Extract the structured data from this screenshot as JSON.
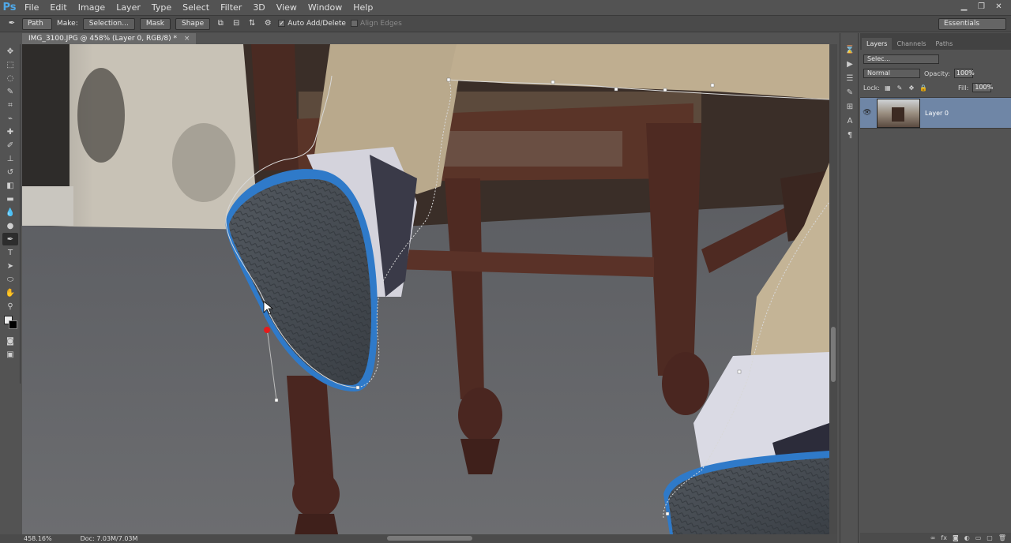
{
  "app": {
    "logo": "Ps"
  },
  "menu": [
    "File",
    "Edit",
    "Image",
    "Layer",
    "Type",
    "Select",
    "Filter",
    "3D",
    "View",
    "Window",
    "Help"
  ],
  "window_controls": {
    "minimize": "▁",
    "restore": "❐",
    "close": "✕"
  },
  "options_bar": {
    "tool_icon": "pen-icon",
    "mode": "Path",
    "make_label": "Make:",
    "selection_btn": "Selection...",
    "mask_btn": "Mask",
    "shape_btn": "Shape",
    "auto_add_delete": "Auto Add/Delete",
    "auto_add_checked": true,
    "align_edges": "Align Edges",
    "workspace": "Essentials"
  },
  "document": {
    "tab_title": "IMG_3100.JPG @ 458% (Layer 0, RGB/8) *",
    "close": "×"
  },
  "status": {
    "zoom": "458.16%",
    "doc": "Doc: 7.03M/7.03M"
  },
  "panels": {
    "tabs": [
      "Layers",
      "Channels",
      "Paths"
    ],
    "active_tab": "Layers",
    "filter_placeholder": "Selec...",
    "blend_mode": "Normal",
    "opacity_label": "Opacity:",
    "opacity": "100%",
    "lock_label": "Lock:",
    "fill_label": "Fill:",
    "fill": "100%",
    "layers": [
      {
        "name": "Layer 0",
        "visible": true,
        "selected": true
      }
    ]
  },
  "colors": {
    "accent": "#4fa8e8",
    "selected_layer": "#6f86a6",
    "anchor_active": "#e51b1b"
  }
}
